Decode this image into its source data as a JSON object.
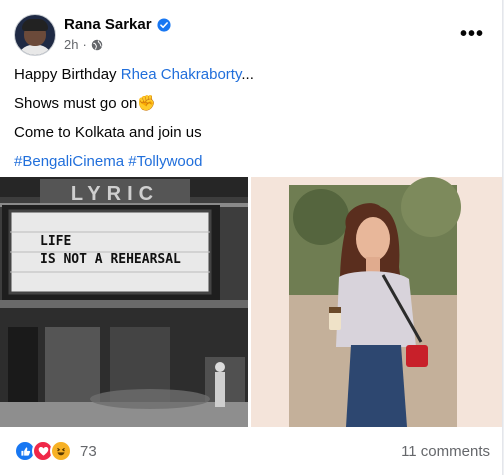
{
  "post": {
    "author": "Rana Sarkar",
    "time": "2h",
    "more_label": "•••"
  },
  "message": {
    "line1_prefix": "Happy Birthday ",
    "line1_mention": "Rhea Chakraborty",
    "line1_suffix": "...",
    "line2_text": "Shows must go on",
    "line2_emoji": "✊",
    "line3": "Come to Kolkata and join us",
    "hashtag1": "#BengaliCinema",
    "hashtag2": "#Tollywood"
  },
  "photos": {
    "marquee_sign": "LYRIC",
    "marquee_line1": "LIFE",
    "marquee_line2": "IS NOT A REHEARSAL"
  },
  "footer": {
    "reaction_count": "73",
    "comments": "11 comments"
  },
  "colors": {
    "link": "#216fdb",
    "verified": "#1877f2",
    "secondary_text": "#65676b"
  }
}
